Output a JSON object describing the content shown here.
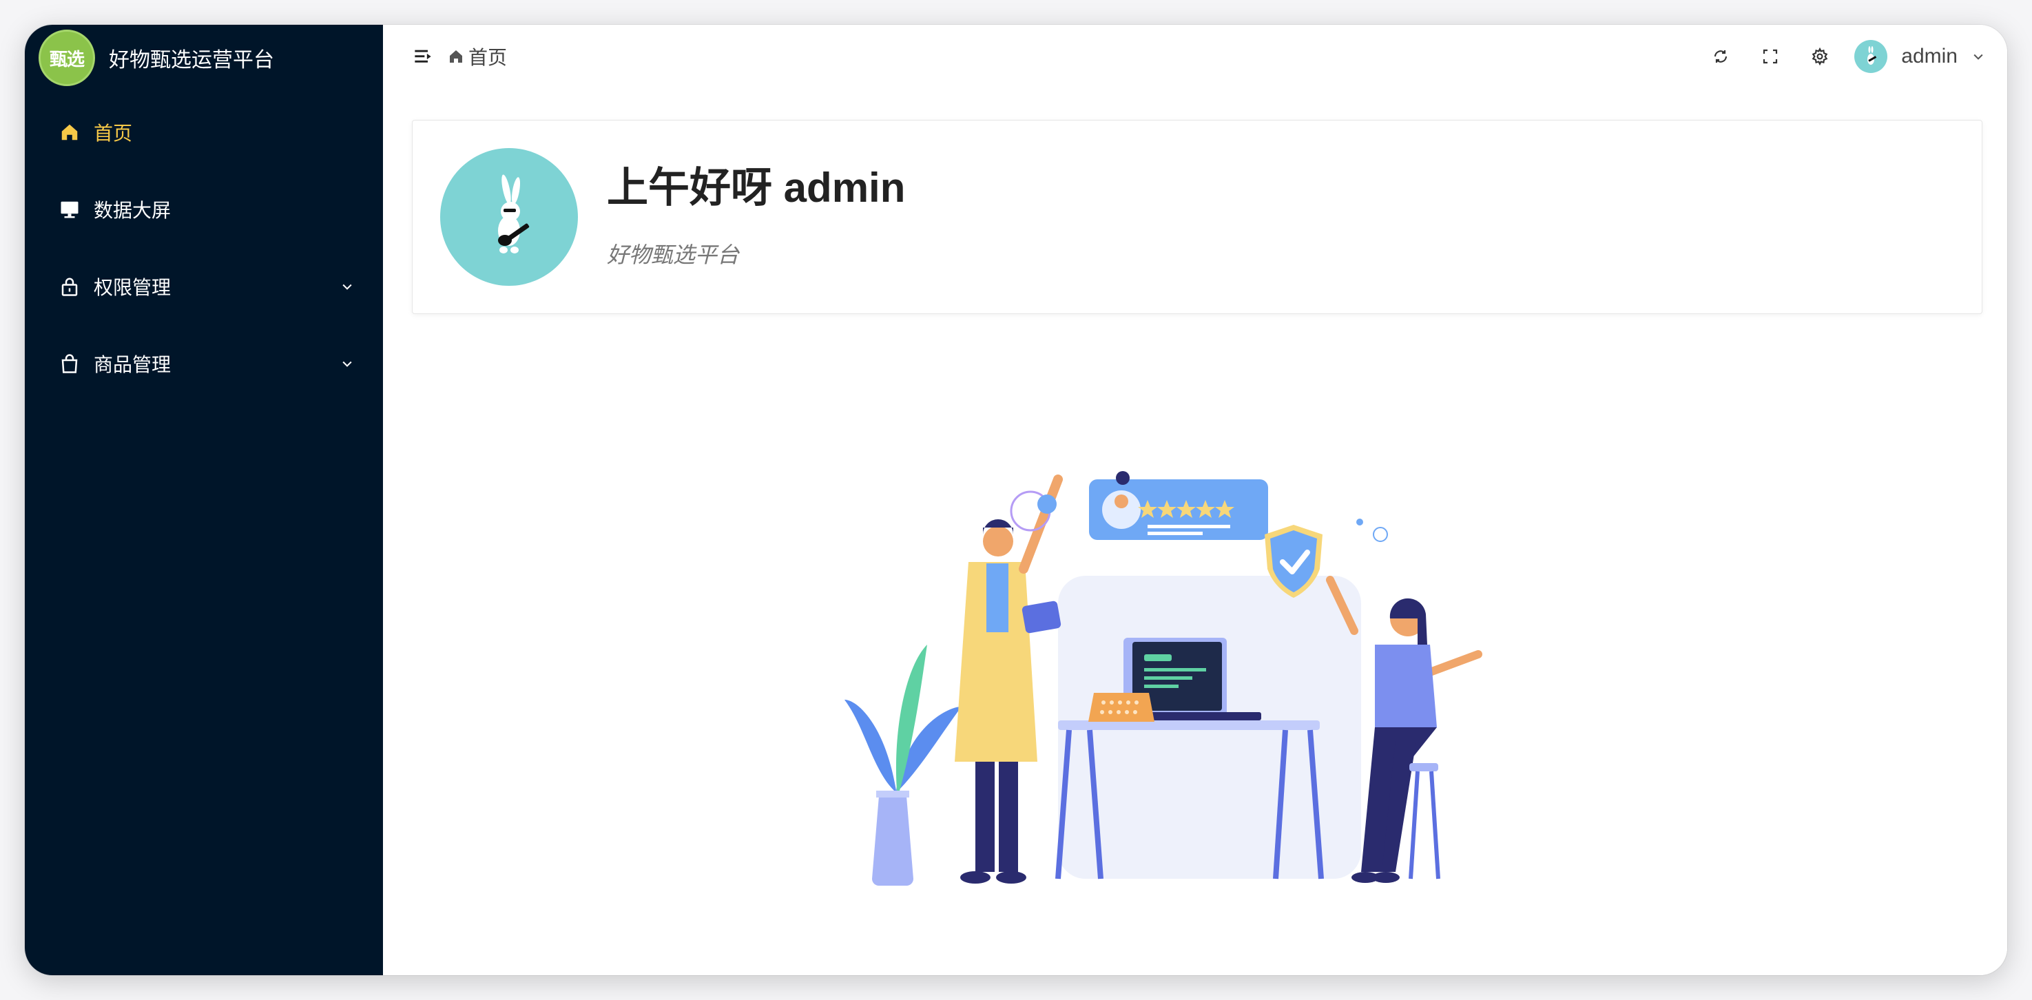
{
  "brand": {
    "logo_text": "甄选",
    "title": "好物甄选运营平台"
  },
  "sidebar": {
    "items": [
      {
        "label": "首页",
        "icon": "home-icon",
        "active": true
      },
      {
        "label": "数据大屏",
        "icon": "monitor-icon",
        "active": false
      },
      {
        "label": "权限管理",
        "icon": "lock-icon",
        "active": false,
        "expandable": true
      },
      {
        "label": "商品管理",
        "icon": "shopping-bag-icon",
        "active": false,
        "expandable": true
      }
    ]
  },
  "topbar": {
    "breadcrumb": "首页",
    "username": "admin",
    "tools": [
      "refresh-icon",
      "fullscreen-icon",
      "settings-icon"
    ]
  },
  "welcome": {
    "greeting": "上午好呀 admin",
    "subtitle": "好物甄选平台"
  },
  "colors": {
    "sidebar_bg": "#001529",
    "active": "#f7c948",
    "avatar_bg": "#7ed3d4",
    "logo_bg": "#8bc34a"
  }
}
